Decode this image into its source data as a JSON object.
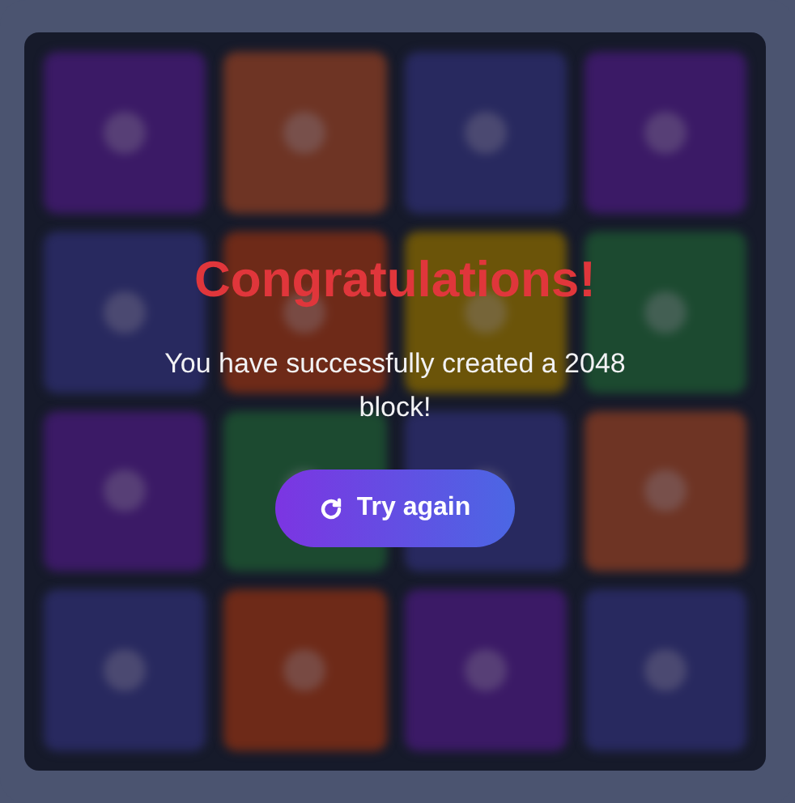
{
  "board": {
    "tiles": [
      {
        "color": "#3b1a66"
      },
      {
        "color": "#6e3424"
      },
      {
        "color": "#28295f"
      },
      {
        "color": "#3b1a66"
      },
      {
        "color": "#28295f"
      },
      {
        "color": "#6e2a18"
      },
      {
        "color": "#6b5409"
      },
      {
        "color": "#1c4a30"
      },
      {
        "color": "#3b1a66"
      },
      {
        "color": "#1c4a30"
      },
      {
        "color": "#28295f"
      },
      {
        "color": "#6e3424"
      },
      {
        "color": "#28295f"
      },
      {
        "color": "#6e2a18"
      },
      {
        "color": "#3b1a66"
      },
      {
        "color": "#28295f"
      }
    ]
  },
  "overlay": {
    "title": "Congratulations!",
    "message": "You have successfully created a 2048 block!",
    "button": {
      "label": "Try again"
    }
  }
}
